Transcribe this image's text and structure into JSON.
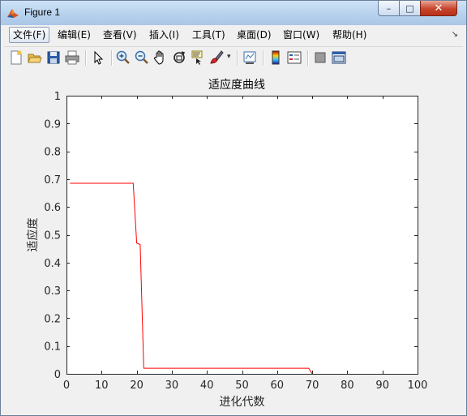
{
  "window": {
    "title": "Figure 1",
    "controls": {
      "minimize": "–",
      "maximize": "□",
      "close": "✕"
    }
  },
  "menubar": {
    "items": [
      "文件(F)",
      "编辑(E)",
      "查看(V)",
      "插入(I)",
      "工具(T)",
      "桌面(D)",
      "窗口(W)",
      "帮助(H)"
    ],
    "active_index": 0
  },
  "toolbar": {
    "icons": [
      "new-figure-icon",
      "open-file-icon",
      "save-icon",
      "print-icon",
      "select-arrow-icon",
      "zoom-in-icon",
      "zoom-out-icon",
      "pan-hand-icon",
      "rotate-3d-icon",
      "data-cursor-icon",
      "brush-icon",
      "link-plot-icon",
      "colorbar-icon",
      "legend-icon",
      "hide-plot-tools-icon",
      "show-plot-tools-icon"
    ]
  },
  "chart_data": {
    "type": "line",
    "title": "适应度曲线",
    "xlabel": "进化代数",
    "ylabel": "适应度",
    "xlim": [
      0,
      100
    ],
    "ylim": [
      0,
      1
    ],
    "xticks": [
      0,
      10,
      20,
      30,
      40,
      50,
      60,
      70,
      80,
      90,
      100
    ],
    "yticks": [
      0,
      0.1,
      0.2,
      0.3,
      0.4,
      0.5,
      0.6,
      0.7,
      0.8,
      0.9,
      1
    ],
    "grid": false,
    "series": [
      {
        "color": "#ff0000",
        "x": [
          1,
          19,
          20,
          21,
          22,
          69,
          70
        ],
        "y": [
          0.685,
          0.685,
          0.47,
          0.465,
          0.02,
          0.02,
          0
        ]
      }
    ]
  }
}
